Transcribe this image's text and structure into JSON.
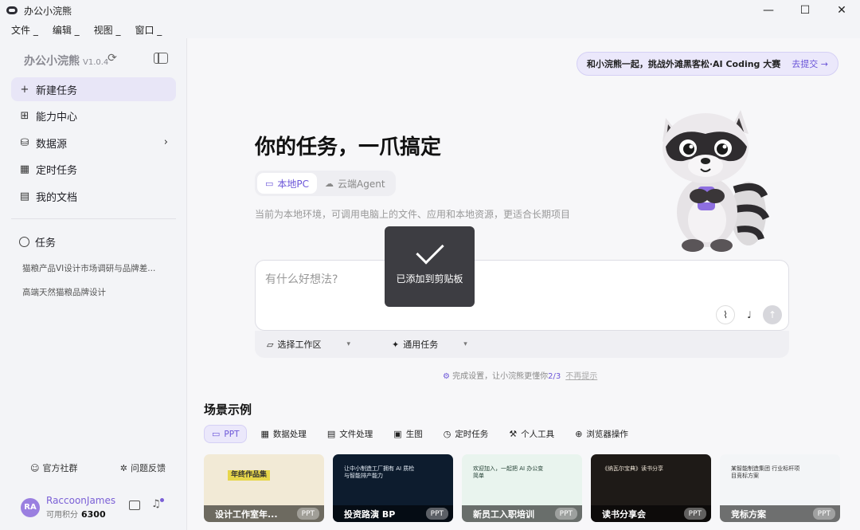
{
  "window": {
    "title": "办公小浣熊",
    "controls": [
      "—",
      "☐",
      "✕"
    ]
  },
  "menu": [
    "文件 _",
    "编辑 _",
    "视图 _",
    "窗口 _"
  ],
  "sidebar": {
    "brand": "办公小浣熊",
    "version": "V1.0.4",
    "nav": [
      {
        "label": "新建任务",
        "icon": "plus-icon"
      },
      {
        "label": "能力中心",
        "icon": "grid-icon"
      },
      {
        "label": "数据源",
        "icon": "database-icon"
      },
      {
        "label": "定时任务",
        "icon": "calendar-icon"
      },
      {
        "label": "我的文档",
        "icon": "document-icon"
      }
    ],
    "tasks_heading": "任务",
    "tasks": [
      "猫粮产品VI设计市场调研与品牌差...",
      "高端天然猫粮品牌设计"
    ],
    "community": "官方社群",
    "feedback": "问题反馈",
    "user": {
      "initials": "RA",
      "name": "RaccoonJames",
      "credit_label": "可用积分",
      "credit_value": "6300"
    }
  },
  "banner": {
    "text": "和小浣熊一起，挑战外滩黑客松·AI Coding 大赛",
    "cta": "去提交 →"
  },
  "hero": {
    "title": "你的任务，一爪搞定",
    "modes": [
      "本地PC",
      "云端Agent"
    ],
    "subtitle": "当前为本地环境，可调用电脑上的文件、应用和本地资源，更适合长期项目"
  },
  "toast": {
    "message": "已添加到剪贴板"
  },
  "input": {
    "placeholder": "有什么好想法?",
    "workspace": "选择工作区",
    "task_type": "通用任务"
  },
  "setup_tip": {
    "text": "完成设置，让小浣熊更懂你",
    "progress": "2/3",
    "dismiss": "不再提示"
  },
  "scenes": {
    "title": "场景示例",
    "tabs": [
      "PPT",
      "数据处理",
      "文件处理",
      "生图",
      "定时任务",
      "个人工具",
      "浏览器操作"
    ],
    "cards": [
      {
        "caption": "设计工作室年...",
        "tag": "PPT",
        "thumb": "年终作品集",
        "bg": "#f2ead6"
      },
      {
        "caption": "投资路演 BP",
        "tag": "PPT",
        "thumb": "让中小制造工厂拥有 AI 质检与智能排产能力",
        "bg": "#0d1c2e"
      },
      {
        "caption": "新员工入职培训",
        "tag": "PPT",
        "thumb": "欢迎加入，一起把 AI 办公变简单",
        "bg": "#e9f4ee"
      },
      {
        "caption": "读书分享会",
        "tag": "PPT",
        "thumb": "《纳瓦尔宝典》读书分享",
        "bg": "#1e1a17"
      },
      {
        "caption": "竞标方案",
        "tag": "PPT",
        "thumb": "某智能制造集团 行业标杆项目竞标方案",
        "bg": "#f3f5f7"
      }
    ]
  },
  "colors": {
    "accent": "#6b55d8",
    "accent_soft": "#ebe8fb",
    "sidebar_bg": "#f3f4f7",
    "toast_bg": "#3d3d42"
  }
}
